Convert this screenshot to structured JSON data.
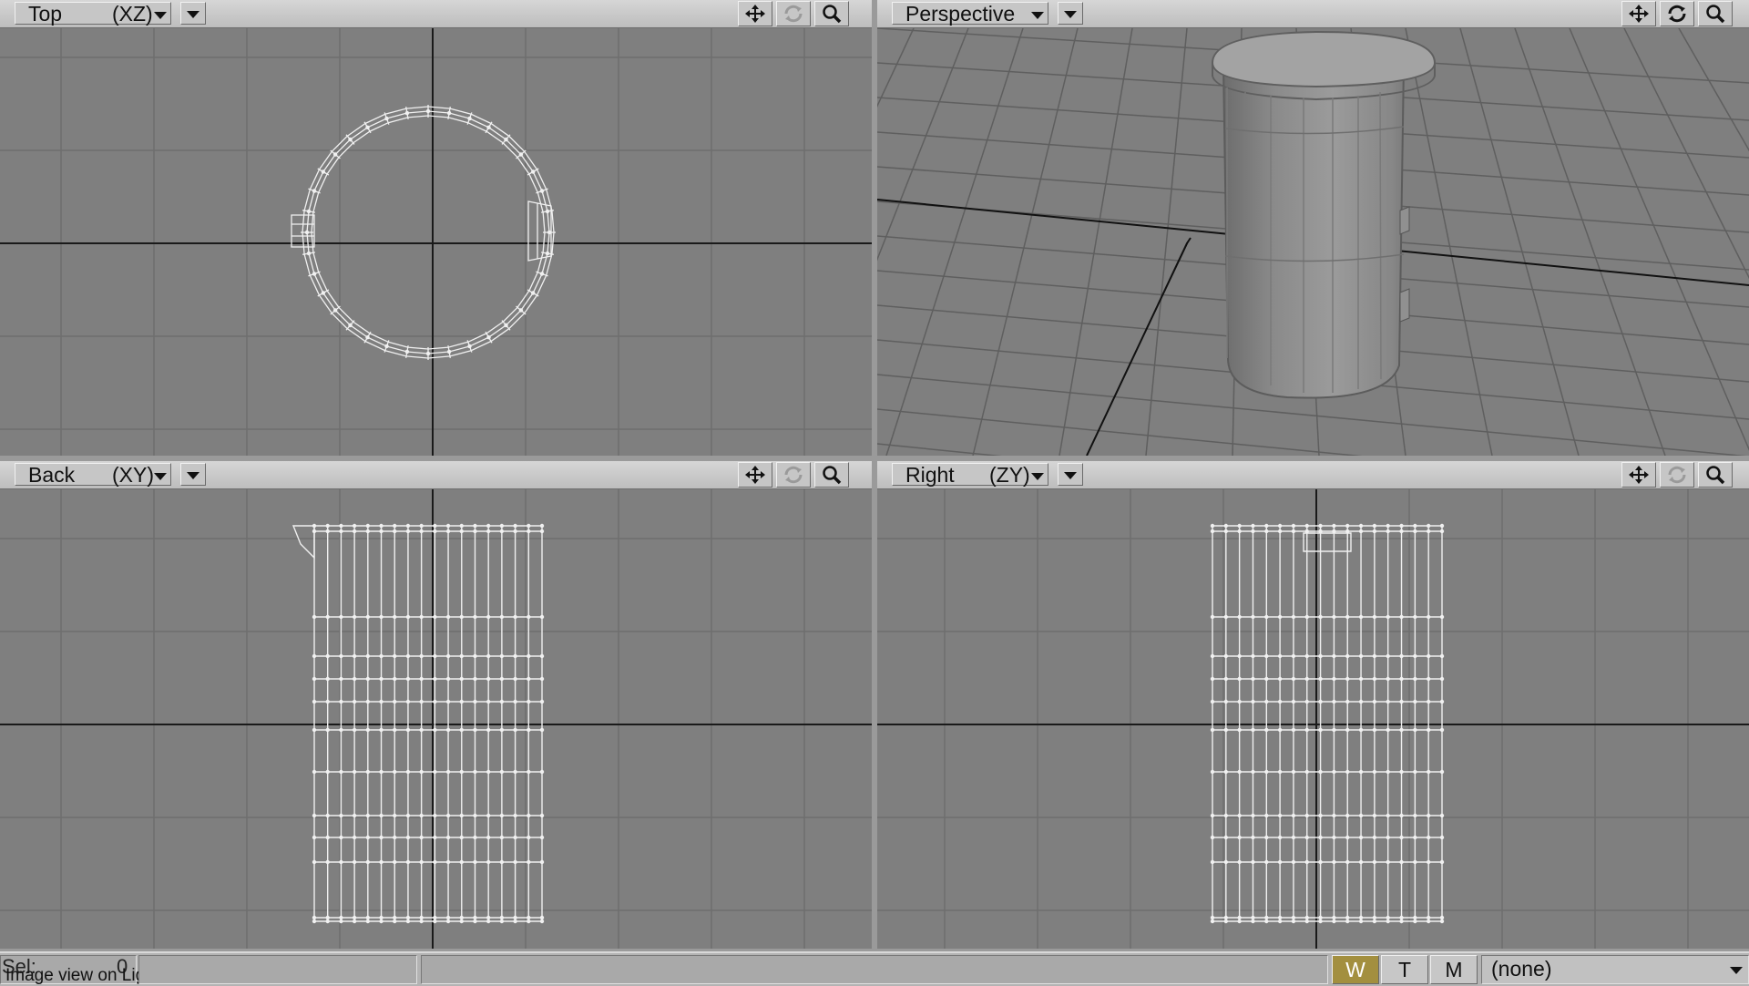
{
  "viewports": {
    "top": {
      "label": "Top",
      "axis": "(XZ)"
    },
    "perspective": {
      "label": "Perspective"
    },
    "back": {
      "label": "Back",
      "axis": "(XY)"
    },
    "right": {
      "label": "Right",
      "axis": "(ZY)"
    }
  },
  "toolbar_icons": [
    "move-icon",
    "rotate-icon",
    "zoom-icon"
  ],
  "status": {
    "sel_label": "Sel:",
    "sel_count": "0",
    "message": "Image view on Lightwave",
    "mode_w": "W",
    "mode_t": "T",
    "mode_m": "M",
    "surface_select": "(none)"
  },
  "colors": {
    "viewport_bg": "#7f7f7f",
    "grid_line": "#6e6e6e",
    "axis_line": "#1a1a1a",
    "wireframe": "#f0f0f0",
    "header_bg": "#c6c6c6"
  }
}
